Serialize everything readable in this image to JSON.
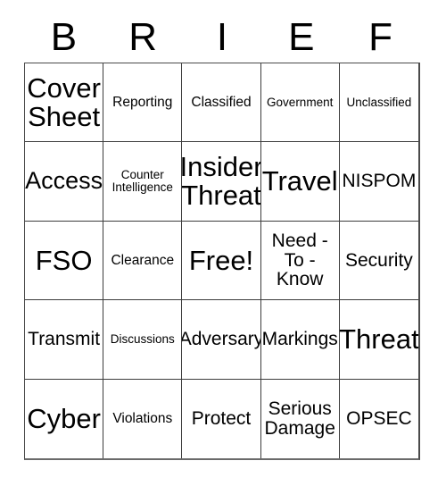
{
  "card": {
    "title": "BRIEF",
    "header_letters": [
      "B",
      "R",
      "I",
      "E",
      "F"
    ],
    "rows": 5,
    "columns": 5,
    "free_space": {
      "row": 3,
      "column": 3,
      "label": "Free!"
    },
    "colors": {
      "background": "#ffffff",
      "text": "#000000",
      "grid_line": "#3d3d3d",
      "outer_border": "#4a4a4a"
    },
    "squares": [
      {
        "id": "b1",
        "text": "Cover\nSheet",
        "size": "xl"
      },
      {
        "id": "r1",
        "text": "Reporting",
        "size": "sm"
      },
      {
        "id": "i1",
        "text": "Classified",
        "size": "sm"
      },
      {
        "id": "e1",
        "text": "Government",
        "size": "xs"
      },
      {
        "id": "f1",
        "text": "Unclassified",
        "size": "xs"
      },
      {
        "id": "b2",
        "text": "Access",
        "size": "lg"
      },
      {
        "id": "r2",
        "text": "Counter\nIntelligence",
        "size": "xs"
      },
      {
        "id": "i2",
        "text": "Insider\nThreat",
        "size": "xl"
      },
      {
        "id": "e2",
        "text": "Travel",
        "size": "xl"
      },
      {
        "id": "f2",
        "text": "NISPOM",
        "size": "md"
      },
      {
        "id": "b3",
        "text": "FSO",
        "size": "xl"
      },
      {
        "id": "r3",
        "text": "Clearance",
        "size": "sm"
      },
      {
        "id": "i3",
        "text": "Free!",
        "size": "xl"
      },
      {
        "id": "e3",
        "text": "Need -\nTo -\nKnow",
        "size": "md"
      },
      {
        "id": "f3",
        "text": "Security",
        "size": "md"
      },
      {
        "id": "b4",
        "text": "Transmit",
        "size": "md"
      },
      {
        "id": "r4",
        "text": "Discussions",
        "size": "xs"
      },
      {
        "id": "i4",
        "text": "Adversary",
        "size": "md"
      },
      {
        "id": "e4",
        "text": "Markings",
        "size": "md"
      },
      {
        "id": "f4",
        "text": "Threat",
        "size": "xl"
      },
      {
        "id": "b5",
        "text": "Cyber",
        "size": "xl"
      },
      {
        "id": "r5",
        "text": "Violations",
        "size": "sm"
      },
      {
        "id": "i5",
        "text": "Protect",
        "size": "md"
      },
      {
        "id": "e5",
        "text": "Serious\nDamage",
        "size": "md"
      },
      {
        "id": "f5",
        "text": "OPSEC",
        "size": "md"
      }
    ]
  }
}
